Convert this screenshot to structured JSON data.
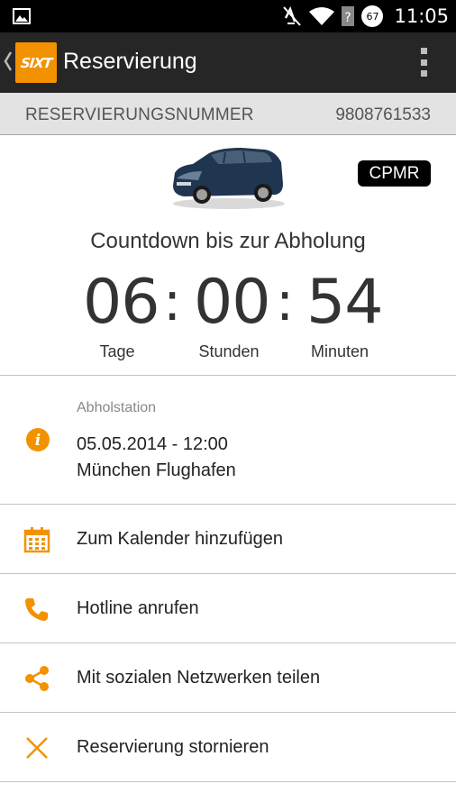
{
  "status_bar": {
    "time": "11:05",
    "battery": "67",
    "icons": [
      "image-icon",
      "mute-icon",
      "wifi-icon",
      "signal-icon",
      "battery-icon"
    ]
  },
  "action_bar": {
    "logo_text": "SIXT",
    "title": "Reservierung",
    "icons": [
      "up-caret-icon",
      "overflow-menu-icon"
    ]
  },
  "reservation": {
    "label": "RESERVIERUNGSNUMMER",
    "number": "9808761533"
  },
  "vehicle": {
    "code": "CPMR",
    "image": "car-image"
  },
  "countdown": {
    "title": "Countdown bis zur Abholung",
    "days": "06",
    "hours": "00",
    "minutes": "54",
    "separator": ":",
    "days_label": "Tage",
    "hours_label": "Stunden",
    "minutes_label": "Minuten"
  },
  "pickup": {
    "label": "Abholstation",
    "datetime": "05.05.2014 - 12:00",
    "location": "München Flughafen",
    "icon": "info-icon"
  },
  "actions": [
    {
      "label": "Zum Kalender hinzufügen",
      "icon": "calendar-icon"
    },
    {
      "label": "Hotline anrufen",
      "icon": "phone-icon"
    },
    {
      "label": "Mit sozialen Netzwerken teilen",
      "icon": "share-icon"
    },
    {
      "label": "Reservierung stornieren",
      "icon": "close-icon"
    }
  ],
  "colors": {
    "accent": "#f39200",
    "action_bar": "#262626",
    "status_bar": "#000000"
  }
}
